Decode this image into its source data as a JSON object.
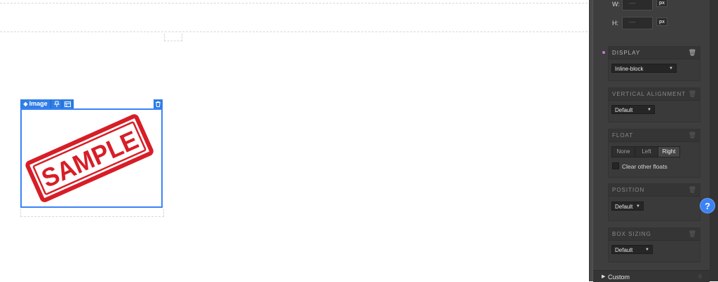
{
  "canvas": {
    "image_element": {
      "tag_label": "Image",
      "stamp_text": "SAMPLE",
      "stamp_color": "#d71e27",
      "selection_color": "#3b82f6"
    }
  },
  "panel": {
    "size": {
      "width_label": "W:",
      "width_value": "----",
      "width_unit": "px",
      "height_label": "H:",
      "height_value": "----",
      "height_unit": "px"
    },
    "display": {
      "title": "DISPLAY",
      "value": "Inline-block"
    },
    "vertical_alignment": {
      "title": "VERTICAL ALIGNMENT",
      "value": "Default"
    },
    "float": {
      "title": "FLOAT",
      "options": [
        "None",
        "Left",
        "Right"
      ],
      "selected": "Right",
      "clear_label": "Clear other floats"
    },
    "position": {
      "title": "POSITION",
      "value": "Default"
    },
    "box_sizing": {
      "title": "BOX SIZING",
      "value": "Default"
    },
    "custom": {
      "label": "Custom"
    }
  },
  "help": {
    "label": "?"
  }
}
